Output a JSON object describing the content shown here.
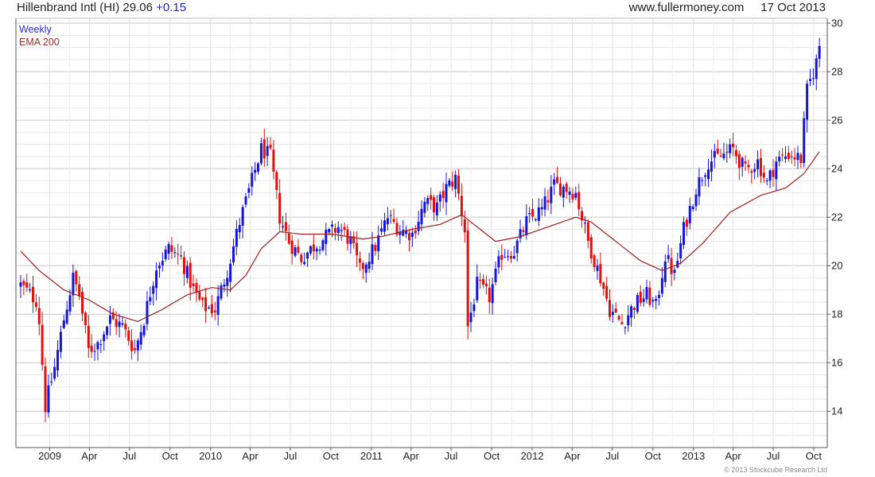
{
  "header": {
    "symbol_text": "Hillenbrand Intl (HI) 29.06",
    "change_text": "+0.15",
    "source": "www.fullermoney.com",
    "date": "17 Oct 2013"
  },
  "legend": {
    "weekly": "Weekly",
    "ema": "EMA 200"
  },
  "copyright": "© 2013 Stockcube Research Ltd",
  "colors": {
    "up": "#1515d8",
    "down": "#e01010",
    "ema": "#9c2020",
    "grid": "#d8d8d8",
    "axis": "#555555"
  },
  "chart_data": {
    "type": "candlestick",
    "frequency": "weekly",
    "title": "Hillenbrand Intl (HI) 29.06 +0.15",
    "ylim": [
      12.5,
      30.2
    ],
    "yticks": [
      14,
      16,
      18,
      20,
      22,
      24,
      26,
      28,
      30
    ],
    "y_axis_position": "right",
    "x_range": [
      "2008-10-27",
      "2013-10-21"
    ],
    "xticks": [
      {
        "label": "2009",
        "date": "2009-01-01"
      },
      {
        "label": "Apr",
        "date": "2009-04-01"
      },
      {
        "label": "Jul",
        "date": "2009-07-01"
      },
      {
        "label": "Oct",
        "date": "2009-10-01"
      },
      {
        "label": "2010",
        "date": "2010-01-01"
      },
      {
        "label": "Apr",
        "date": "2010-04-01"
      },
      {
        "label": "Jul",
        "date": "2010-07-01"
      },
      {
        "label": "Oct",
        "date": "2010-10-01"
      },
      {
        "label": "2011",
        "date": "2011-01-01"
      },
      {
        "label": "Apr",
        "date": "2011-04-01"
      },
      {
        "label": "Jul",
        "date": "2011-07-01"
      },
      {
        "label": "Oct",
        "date": "2011-10-01"
      },
      {
        "label": "2012",
        "date": "2012-01-01"
      },
      {
        "label": "Apr",
        "date": "2012-04-01"
      },
      {
        "label": "Jul",
        "date": "2012-07-01"
      },
      {
        "label": "Oct",
        "date": "2012-10-01"
      },
      {
        "label": "2013",
        "date": "2013-01-01"
      },
      {
        "label": "Apr",
        "date": "2013-04-01"
      },
      {
        "label": "Jul",
        "date": "2013-07-01"
      },
      {
        "label": "Oct",
        "date": "2013-10-01"
      }
    ],
    "grid": true,
    "close_anchors": [
      [
        "2008-10-27",
        19.2
      ],
      [
        "2008-12-05",
        18.5
      ],
      [
        "2008-12-22",
        14.2
      ],
      [
        "2009-01-12",
        15.8
      ],
      [
        "2009-02-02",
        17.8
      ],
      [
        "2009-02-23",
        19.5
      ],
      [
        "2009-03-09",
        18.8
      ],
      [
        "2009-03-30",
        16.5
      ],
      [
        "2009-04-20",
        16.8
      ],
      [
        "2009-05-18",
        17.8
      ],
      [
        "2009-06-15",
        17.5
      ],
      [
        "2009-07-13",
        16.5
      ],
      [
        "2009-08-03",
        17.8
      ],
      [
        "2009-08-31",
        20.0
      ],
      [
        "2009-09-28",
        20.7
      ],
      [
        "2009-10-26",
        20.3
      ],
      [
        "2009-11-23",
        19.0
      ],
      [
        "2009-12-14",
        18.3
      ],
      [
        "2010-01-11",
        18.2
      ],
      [
        "2010-02-08",
        19.8
      ],
      [
        "2010-03-08",
        21.8
      ],
      [
        "2010-04-05",
        23.5
      ],
      [
        "2010-04-26",
        24.8
      ],
      [
        "2010-05-17",
        24.5
      ],
      [
        "2010-06-07",
        22.0
      ],
      [
        "2010-06-28",
        21.0
      ],
      [
        "2010-07-26",
        20.3
      ],
      [
        "2010-08-23",
        20.8
      ],
      [
        "2010-09-20",
        21.2
      ],
      [
        "2010-10-18",
        21.6
      ],
      [
        "2010-11-15",
        21.0
      ],
      [
        "2010-12-06",
        19.8
      ],
      [
        "2011-01-10",
        20.8
      ],
      [
        "2011-02-07",
        22.0
      ],
      [
        "2011-03-07",
        21.5
      ],
      [
        "2011-04-04",
        21.3
      ],
      [
        "2011-05-02",
        22.6
      ],
      [
        "2011-05-30",
        22.4
      ],
      [
        "2011-06-20",
        23.2
      ],
      [
        "2011-07-11",
        23.6
      ],
      [
        "2011-08-01",
        21.5
      ],
      [
        "2011-08-08",
        17.5
      ],
      [
        "2011-08-29",
        19.2
      ],
      [
        "2011-09-26",
        18.7
      ],
      [
        "2011-10-24",
        20.5
      ],
      [
        "2011-11-21",
        20.6
      ],
      [
        "2011-12-19",
        21.8
      ],
      [
        "2012-01-23",
        22.3
      ],
      [
        "2012-02-20",
        23.3
      ],
      [
        "2012-03-19",
        23.2
      ],
      [
        "2012-04-09",
        23.0
      ],
      [
        "2012-05-07",
        21.0
      ],
      [
        "2012-06-04",
        19.5
      ],
      [
        "2012-06-25",
        18.2
      ],
      [
        "2012-07-23",
        17.6
      ],
      [
        "2012-08-20",
        18.4
      ],
      [
        "2012-09-17",
        18.8
      ],
      [
        "2012-10-08",
        18.3
      ],
      [
        "2012-10-29",
        20.4
      ],
      [
        "2012-11-19",
        19.6
      ],
      [
        "2012-12-10",
        21.5
      ],
      [
        "2013-01-07",
        23.2
      ],
      [
        "2013-02-04",
        24.3
      ],
      [
        "2013-03-04",
        24.5
      ],
      [
        "2013-04-01",
        24.8
      ],
      [
        "2013-04-29",
        23.9
      ],
      [
        "2013-05-27",
        24.3
      ],
      [
        "2013-06-17",
        23.4
      ],
      [
        "2013-07-08",
        24.3
      ],
      [
        "2013-08-05",
        24.6
      ],
      [
        "2013-09-02",
        24.4
      ],
      [
        "2013-09-16",
        27.2
      ],
      [
        "2013-10-07",
        28.4
      ],
      [
        "2013-10-14",
        29.06
      ]
    ],
    "ema_anchors": [
      [
        "2008-10-27",
        20.6
      ],
      [
        "2008-12-08",
        19.8
      ],
      [
        "2009-02-02",
        19.0
      ],
      [
        "2009-03-30",
        18.6
      ],
      [
        "2009-05-25",
        18.0
      ],
      [
        "2009-07-20",
        17.7
      ],
      [
        "2009-09-14",
        18.2
      ],
      [
        "2009-11-09",
        18.8
      ],
      [
        "2010-01-04",
        19.1
      ],
      [
        "2010-02-15",
        19.0
      ],
      [
        "2010-03-22",
        19.6
      ],
      [
        "2010-04-26",
        20.7
      ],
      [
        "2010-06-07",
        21.4
      ],
      [
        "2010-07-26",
        21.3
      ],
      [
        "2010-10-04",
        21.3
      ],
      [
        "2010-12-13",
        21.1
      ],
      [
        "2011-01-24",
        21.2
      ],
      [
        "2011-04-04",
        21.5
      ],
      [
        "2011-06-06",
        21.7
      ],
      [
        "2011-07-25",
        22.1
      ],
      [
        "2011-08-29",
        21.6
      ],
      [
        "2011-10-10",
        21.0
      ],
      [
        "2011-12-05",
        21.2
      ],
      [
        "2012-02-06",
        21.6
      ],
      [
        "2012-04-09",
        22.0
      ],
      [
        "2012-05-14",
        21.8
      ],
      [
        "2012-07-09",
        21.0
      ],
      [
        "2012-09-03",
        20.2
      ],
      [
        "2012-10-22",
        19.8
      ],
      [
        "2012-12-03",
        20.1
      ],
      [
        "2013-01-21",
        20.9
      ],
      [
        "2013-03-25",
        22.2
      ],
      [
        "2013-06-03",
        22.9
      ],
      [
        "2013-07-29",
        23.2
      ],
      [
        "2013-09-09",
        23.8
      ],
      [
        "2013-10-14",
        24.7
      ]
    ]
  }
}
